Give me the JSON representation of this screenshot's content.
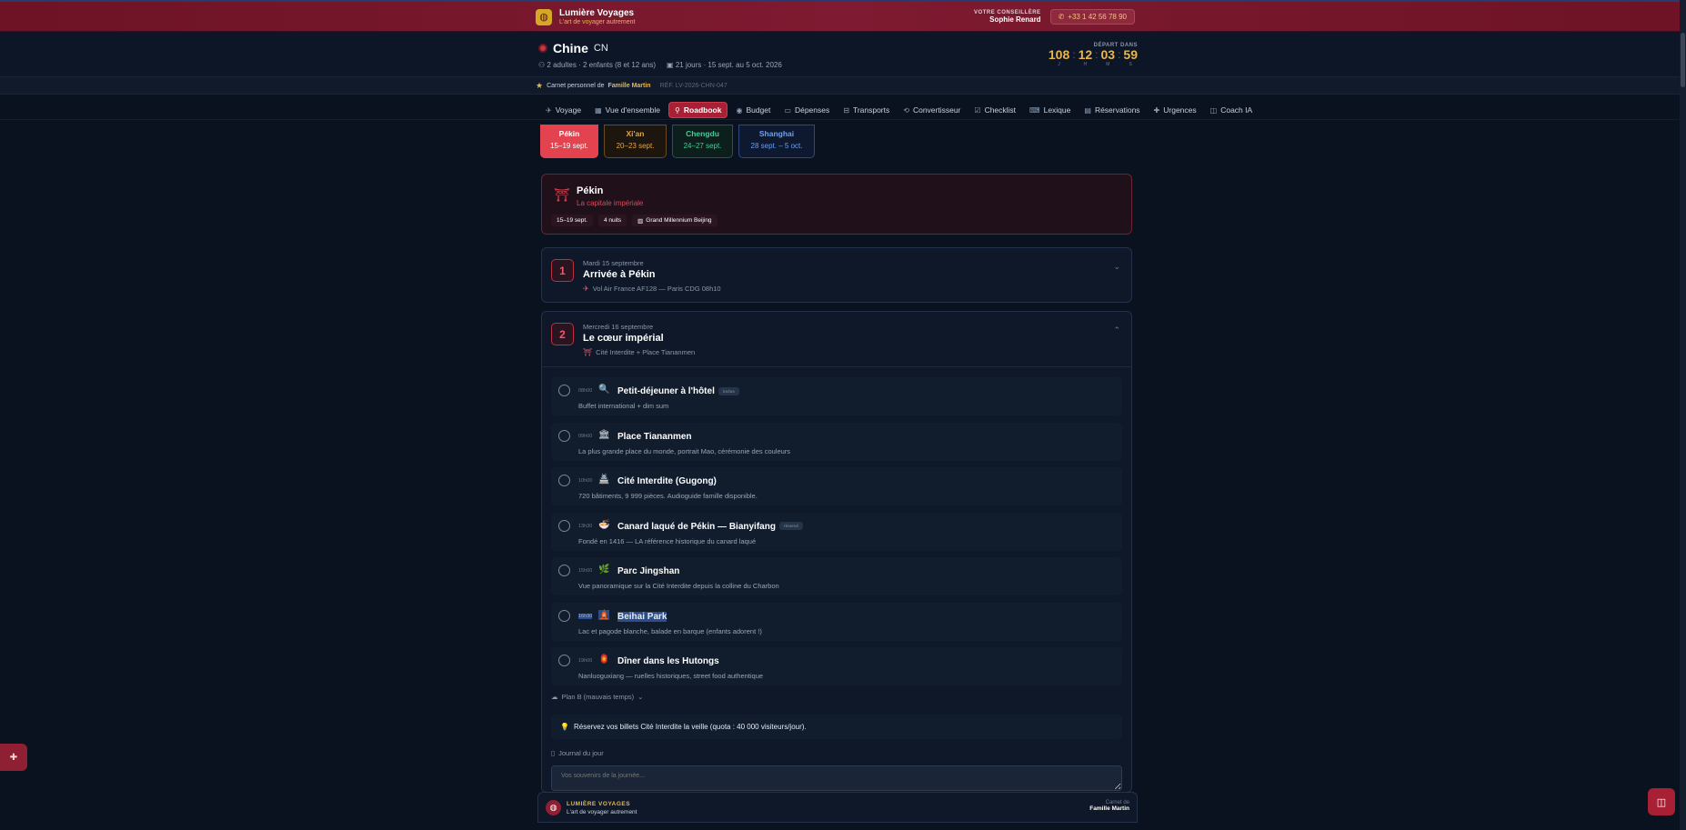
{
  "agency": {
    "name": "Lumière Voyages",
    "tagline": "L'art de voyager autrement",
    "advisor_label": "VOTRE CONSEILLÈRE",
    "advisor_name": "Sophie Renard",
    "phone": "+33 1 42 56 78 90"
  },
  "trip": {
    "destination": "Chine",
    "country_code": "CN",
    "travelers": "2 adultes · 2 enfants (8 et 12 ans)",
    "dates": "21 jours · 15 sept. au 5 oct. 2026",
    "countdown_label": "DÉPART DANS",
    "countdown": [
      {
        "value": "108",
        "unit": "J"
      },
      {
        "value": "12",
        "unit": "H"
      },
      {
        "value": "03",
        "unit": "M"
      },
      {
        "value": "59",
        "unit": "S"
      }
    ]
  },
  "notebook": {
    "label": "Carnet personnel de",
    "family": "Famille Martin",
    "ref": "RÉF. LV-2026-CHN-047"
  },
  "nav": [
    {
      "label": "Voyage",
      "icon": "plane-icon",
      "glyph": "✈"
    },
    {
      "label": "Vue d'ensemble",
      "icon": "grid-icon",
      "glyph": "▦"
    },
    {
      "label": "Roadbook",
      "icon": "pin-icon",
      "glyph": "⚲",
      "active": true
    },
    {
      "label": "Budget",
      "icon": "wallet-icon",
      "glyph": "◉"
    },
    {
      "label": "Dépenses",
      "icon": "card-icon",
      "glyph": "▭"
    },
    {
      "label": "Transports",
      "icon": "bus-icon",
      "glyph": "⊟"
    },
    {
      "label": "Convertisseur",
      "icon": "exchange-icon",
      "glyph": "⟲"
    },
    {
      "label": "Checklist",
      "icon": "check-icon",
      "glyph": "☑"
    },
    {
      "label": "Lexique",
      "icon": "language-icon",
      "glyph": "⌨"
    },
    {
      "label": "Réservations",
      "icon": "document-icon",
      "glyph": "▤"
    },
    {
      "label": "Urgences",
      "icon": "medical-icon",
      "glyph": "✚"
    },
    {
      "label": "Coach IA",
      "icon": "robot-icon",
      "glyph": "◫"
    }
  ],
  "cities": [
    {
      "name": "Pékin",
      "dates": "15–19 sept."
    },
    {
      "name": "Xi'an",
      "dates": "20–23 sept."
    },
    {
      "name": "Chengdu",
      "dates": "24–27 sept."
    },
    {
      "name": "Shanghai",
      "dates": "28 sept. – 5 oct."
    }
  ],
  "city_card": {
    "title": "Pékin",
    "subtitle": "La capitale impériale",
    "chip_dates": "15–19 sept.",
    "chip_nights": "4 nuits",
    "chip_hotel": "Grand Millennium Beijing"
  },
  "days": [
    {
      "number": "1",
      "date": "Mardi 15 septembre",
      "title": "Arrivée à Pékin",
      "subtitle": "Vol Air France AF128 — Paris CDG 08h10"
    },
    {
      "number": "2",
      "date": "Mercredi 16 septembre",
      "title": "Le cœur impérial",
      "subtitle": "Cité Interdite + Place Tiananmen",
      "activities": [
        {
          "time": "08h00",
          "icon": "search-icon",
          "glyph": "🔍",
          "title": "Petit-déjeuner à l'hôtel",
          "badge": "inclus",
          "desc": "Buffet international + dim sum"
        },
        {
          "time": "09h00",
          "icon": "temple-icon",
          "glyph": "🏛",
          "title": "Place Tiananmen",
          "desc": "La plus grande place du monde, portrait Mao, cérémonie des couleurs"
        },
        {
          "time": "10h00",
          "icon": "palace-icon",
          "glyph": "🏯",
          "title": "Cité Interdite (Gugong)",
          "desc": "720 bâtiments, 9 999 pièces. Audioguide famille disponible."
        },
        {
          "time": "13h30",
          "icon": "duck-icon",
          "glyph": "🍜",
          "title": "Canard laqué de Pékin — Bianyifang",
          "badge": "réservé",
          "desc": "Fondé en 1416 — LA référence historique du canard laqué"
        },
        {
          "time": "15h00",
          "icon": "leaf-icon",
          "glyph": "🌿",
          "title": "Parc Jingshan",
          "desc": "Vue panoramique sur la Cité Interdite depuis la colline du Charbon"
        },
        {
          "time": "16h30",
          "icon": "pagoda-icon",
          "glyph": "🛕",
          "title": "Beihai Park",
          "desc": "Lac et pagode blanche, balade en barque (enfants adorent !)",
          "selected": true
        },
        {
          "time": "19h00",
          "icon": "lantern-icon",
          "glyph": "🏮",
          "title": "Dîner dans les Hutongs",
          "desc": "Nanluoguxiang — ruelles historiques, street food authentique"
        }
      ],
      "plan_b": "Plan B (mauvais temps)",
      "tip": "Réservez vos billets Cité Interdite la veille (quota : 40 000 visiteurs/jour).",
      "journal_label": "Journal du jour",
      "journal_placeholder": "Vos souvenirs de la journée..."
    }
  ],
  "footer": {
    "name": "LUMIÈRE VOYAGES",
    "tagline": "L'art de voyager autrement",
    "right_label": "Carnet de",
    "right_name": "Famille Martin"
  },
  "colors": {
    "accent": "#a91f33",
    "gold": "#e8b64a",
    "background": "#0a1220"
  }
}
